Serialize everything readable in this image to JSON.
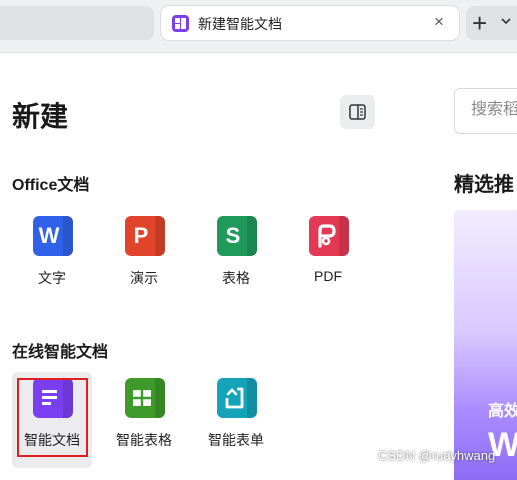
{
  "tab": {
    "title": "新建智能文档",
    "close_glyph": "×",
    "new_tab_glyph": "+",
    "dropdown_glyph": "⌄"
  },
  "page": {
    "title": "新建",
    "search_placeholder": "搜索稻"
  },
  "office_section": {
    "title": "Office文档",
    "items": [
      {
        "label": "文字",
        "letter": "W",
        "color": "#2f62e8",
        "icon": "word-icon"
      },
      {
        "label": "演示",
        "letter": "P",
        "color": "#e0442a",
        "icon": "presentation-icon"
      },
      {
        "label": "表格",
        "letter": "S",
        "color": "#1f9a5a",
        "icon": "spreadsheet-icon"
      },
      {
        "label": "PDF",
        "letter": "",
        "color": "#e23a55",
        "icon": "pdf-icon"
      }
    ]
  },
  "online_section": {
    "title": "在线智能文档",
    "items": [
      {
        "label": "智能文档",
        "color": "#7b3ff2",
        "icon": "smart-document-icon"
      },
      {
        "label": "智能表格",
        "color": "#3d9a2b",
        "icon": "smart-sheet-icon"
      },
      {
        "label": "智能表单",
        "color": "#14a3b8",
        "icon": "smart-form-icon"
      }
    ]
  },
  "featured": {
    "title": "精选推",
    "banner_line1": "高效",
    "banner_line2": "W"
  },
  "watermark": "CSDN @rudyhwang"
}
